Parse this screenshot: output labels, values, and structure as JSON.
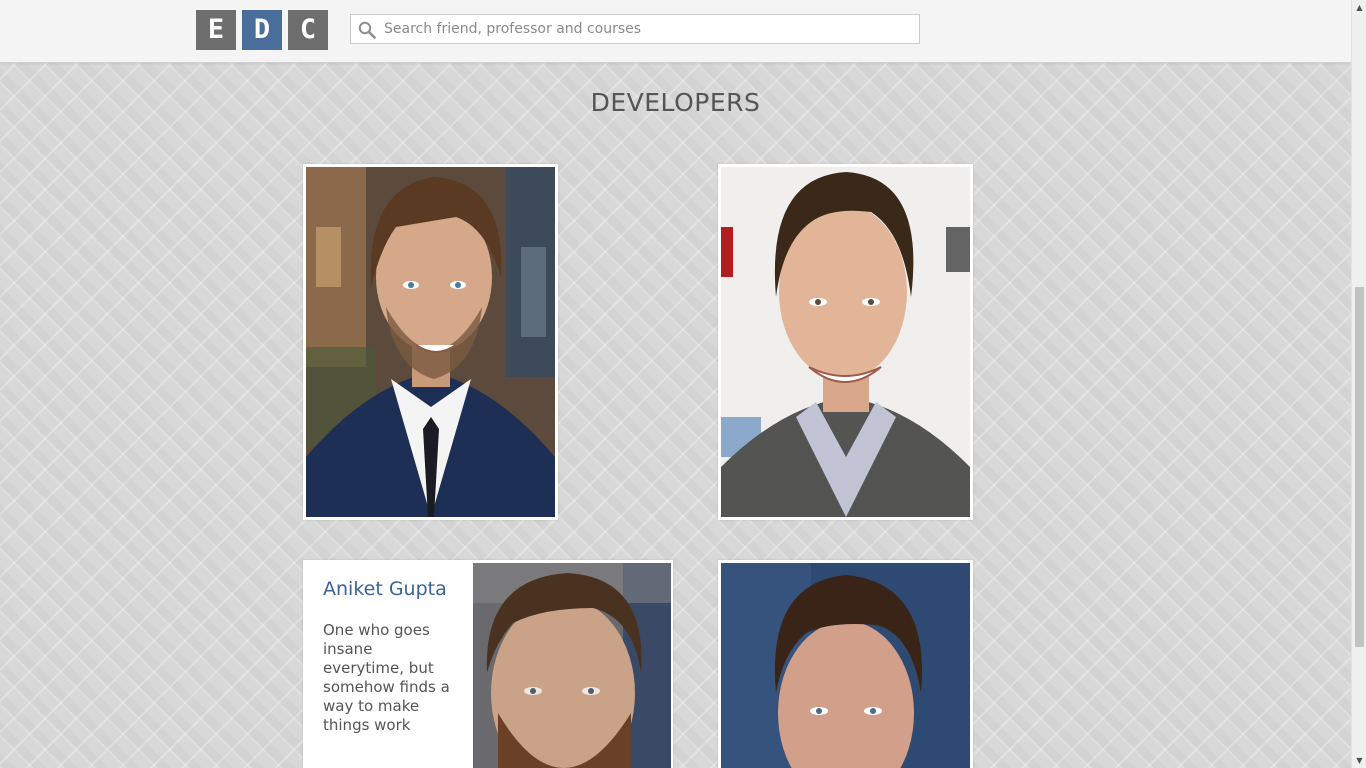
{
  "header": {
    "logo_letters": [
      "E",
      "D",
      "C"
    ],
    "logo_colors": [
      "#6e6e6e",
      "#4a6e9c",
      "#6e6e6e"
    ],
    "search": {
      "placeholder": "Search friend, professor and courses",
      "value": "",
      "icon": "search-icon"
    }
  },
  "main": {
    "title": "DEVELOPERS",
    "developers": [
      {
        "name": "",
        "description": ""
      },
      {
        "name": "",
        "description": ""
      },
      {
        "name": "Aniket Gupta",
        "description": "One who goes insane everytime, but somehow finds a way to make things work"
      },
      {
        "name": "",
        "description": ""
      }
    ]
  },
  "colors": {
    "accent": "#3a6496",
    "background": "#d8d8d8",
    "header_bg": "#f4f4f4"
  }
}
